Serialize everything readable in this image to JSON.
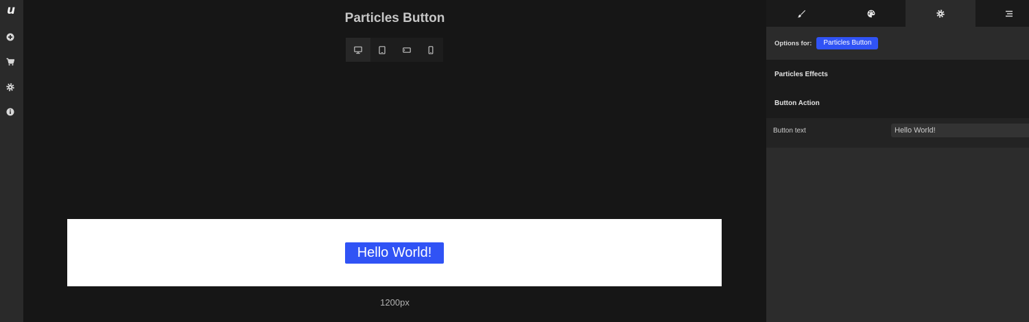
{
  "app": {
    "logo_text": "u"
  },
  "sidebar": {
    "items": [
      {
        "icon": "plus-circle-icon"
      },
      {
        "icon": "cart-icon"
      },
      {
        "icon": "gear-icon"
      },
      {
        "icon": "info-icon"
      }
    ]
  },
  "canvas": {
    "title": "Particles Button",
    "devices": [
      {
        "icon": "desktop-icon",
        "active": true
      },
      {
        "icon": "tablet-icon",
        "active": false
      },
      {
        "icon": "tablet-landscape-icon",
        "active": false
      },
      {
        "icon": "mobile-icon",
        "active": false
      }
    ],
    "preview_button_label": "Hello World!",
    "viewport_width_label": "1200px"
  },
  "panel": {
    "tabs": [
      {
        "icon": "brush-icon",
        "active": false
      },
      {
        "icon": "palette-icon",
        "active": false
      },
      {
        "icon": "gear-icon",
        "active": true
      },
      {
        "icon": "menu-icon",
        "active": false
      }
    ],
    "options_for_label": "Options for:",
    "options_for_target": "Particles Button",
    "sections": [
      {
        "title": "Particles Effects"
      },
      {
        "title": "Button Action"
      }
    ],
    "fields": [
      {
        "label": "Button text",
        "value": "Hello World!"
      }
    ]
  },
  "colors": {
    "accent": "#3053f5",
    "canvas_bg": "#161616",
    "sidebar_bg": "#2a2a2a",
    "panel_bg": "#2c2c2c"
  }
}
